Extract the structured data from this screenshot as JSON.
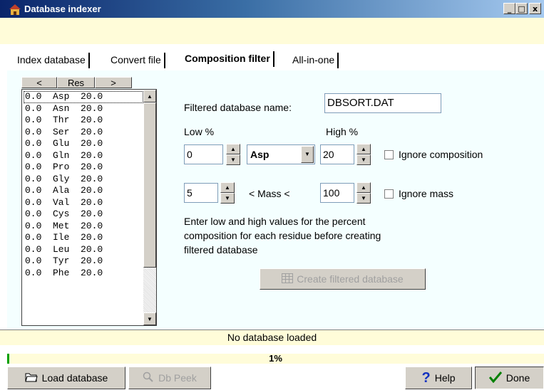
{
  "window": {
    "title": "Database indexer",
    "minimize": "_",
    "maximize": "□",
    "close": "x"
  },
  "tabs": [
    {
      "label": "Index database"
    },
    {
      "label": "Convert file"
    },
    {
      "label": "Composition filter"
    },
    {
      "label": "All-in-one"
    }
  ],
  "list": {
    "header_left": "<",
    "header_mid": "Res",
    "header_right": ">",
    "rows": [
      "0.0  Asp  20.0",
      "0.0  Asn  20.0",
      "0.0  Thr  20.0",
      "0.0  Ser  20.0",
      "0.0  Glu  20.0",
      "0.0  Gln  20.0",
      "0.0  Pro  20.0",
      "0.0  Gly  20.0",
      "0.0  Ala  20.0",
      "0.0  Val  20.0",
      "0.0  Cys  20.0",
      "0.0  Met  20.0",
      "0.0  Ile  20.0",
      "0.0  Leu  20.0",
      "0.0  Tyr  20.0",
      "0.0  Phe  20.0"
    ]
  },
  "form": {
    "filtered_name_label": "Filtered database name:",
    "filtered_name_value": "DBSORT.DAT",
    "low_label": "Low %",
    "high_label": "High %",
    "low_value": "0",
    "residue_value": "Asp",
    "high_value": "20",
    "ignore_composition_label": "Ignore composition",
    "mass_low_value": "5",
    "mass_label": "< Mass <",
    "mass_high_value": "100",
    "ignore_mass_label": "Ignore mass",
    "help_line1": "Enter low and high values for the percent",
    "help_line2": "composition for each residue before creating",
    "help_line3": "filtered database",
    "create_button": "Create filtered database"
  },
  "status": {
    "message": "No database loaded",
    "progress_text": "1%",
    "progress": 0.01
  },
  "buttons": {
    "load": "Load database",
    "peek": "Db Peek",
    "help": "Help",
    "done": "Done"
  },
  "colors": {
    "cream": "#fffcd9",
    "panel": "#f4ffff",
    "title_start": "#0a246a",
    "progress": "#00a000"
  }
}
